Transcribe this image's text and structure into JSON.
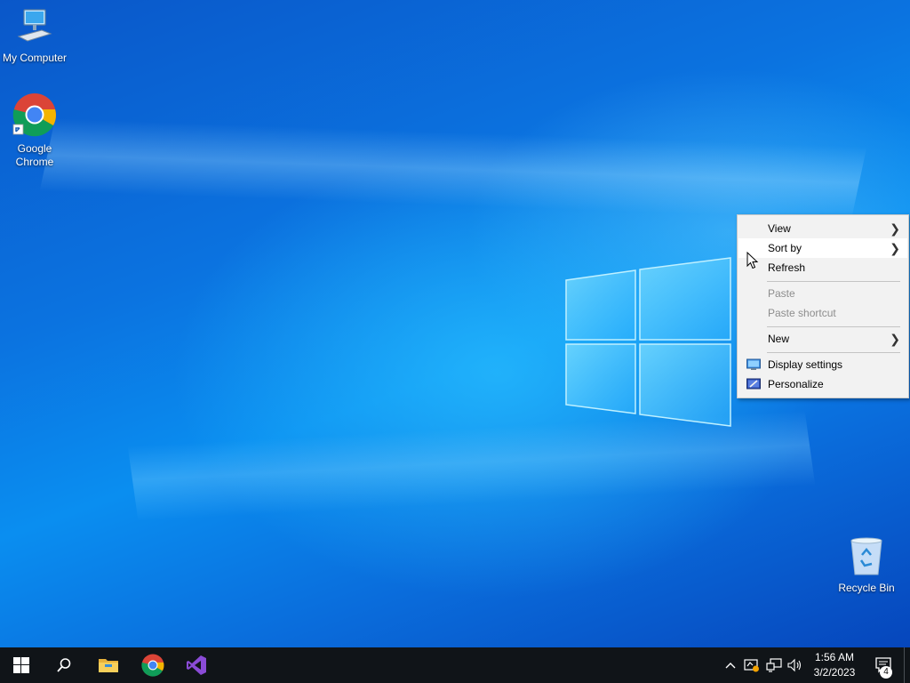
{
  "desktop": {
    "icons": [
      {
        "label": "My Computer"
      },
      {
        "label_line1": "Google",
        "label_line2": "Chrome"
      },
      {
        "label": "Recycle Bin"
      }
    ]
  },
  "context_menu": {
    "items": {
      "view": "View",
      "sort_by": "Sort by",
      "refresh": "Refresh",
      "paste": "Paste",
      "paste_shortcut": "Paste shortcut",
      "new": "New",
      "display_settings": "Display settings",
      "personalize": "Personalize"
    },
    "hovered_item": "Sort by",
    "disabled_items": [
      "Paste",
      "Paste shortcut"
    ]
  },
  "taskbar": {
    "pinned": [
      "start-icon",
      "search-icon",
      "file-explorer-icon",
      "chrome-icon",
      "visual-studio-icon"
    ],
    "tray_icons": [
      "chevron-up-icon",
      "security-alert-icon",
      "network-icon",
      "volume-icon"
    ],
    "clock": {
      "time": "1:56 AM",
      "date": "3/2/2023"
    },
    "notifications_count": "4"
  },
  "colors": {
    "taskbar": "#101418",
    "menu_bg": "#f2f2f2",
    "menu_hover": "#ffffff",
    "disabled_text": "#8d8d8d",
    "accent_blue": "#0a78e6"
  }
}
